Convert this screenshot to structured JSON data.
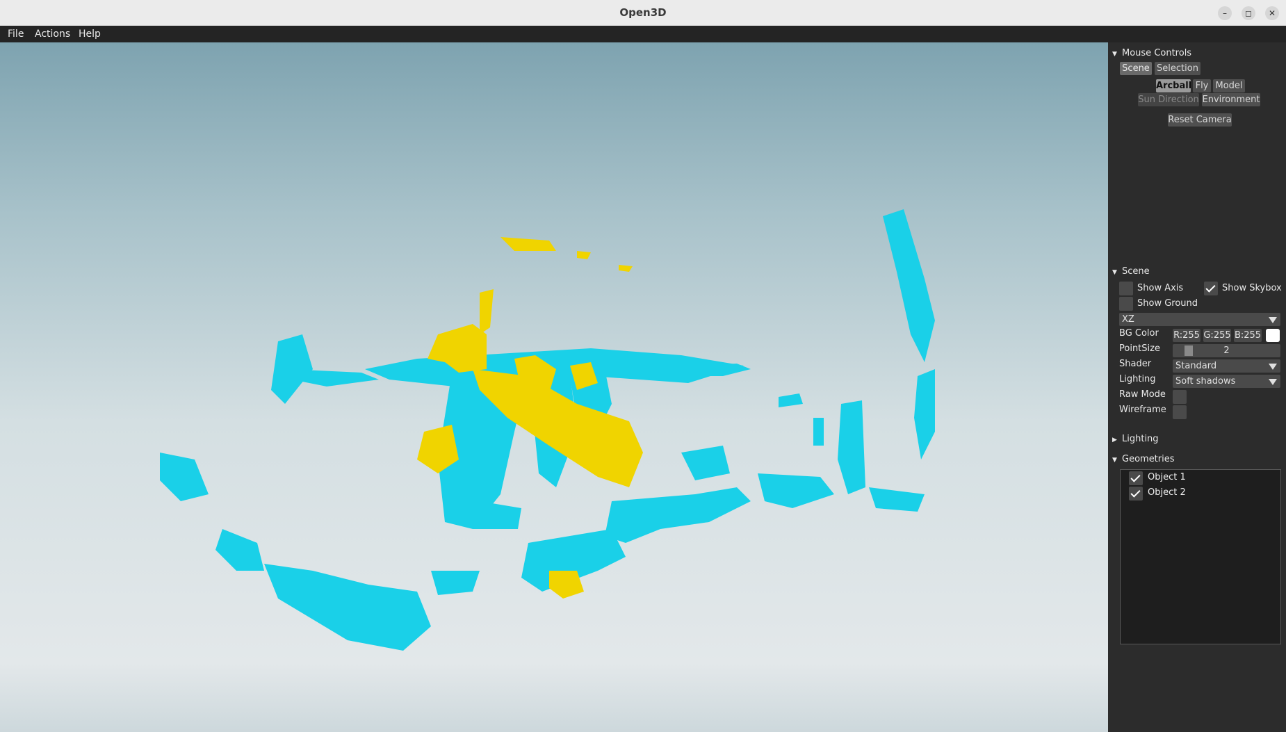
{
  "window": {
    "title": "Open3D",
    "controls": {
      "minimize": "–",
      "maximize": "◻",
      "close": "✕"
    }
  },
  "menu": {
    "file": "File",
    "actions": "Actions",
    "help": "Help"
  },
  "colors": {
    "cloud_cyan": "#1ad0e8",
    "cloud_yellow": "#f0d400",
    "panel_bg": "#2c2c2c"
  },
  "mouse_controls": {
    "header": "Mouse Controls",
    "tabs": {
      "scene": "Scene",
      "selection": "Selection"
    },
    "modes": {
      "arcball": "Arcball",
      "fly": "Fly",
      "model": "Model",
      "sun_direction": "Sun Direction",
      "environment": "Environment"
    },
    "reset_camera": "Reset Camera"
  },
  "scene": {
    "header": "Scene",
    "show_axis": {
      "label": "Show Axis",
      "checked": false
    },
    "show_skybox": {
      "label": "Show Skybox",
      "checked": true
    },
    "show_ground": {
      "label": "Show Ground",
      "checked": false
    },
    "ground_plane": "XZ",
    "bg_color": {
      "label": "BG Color",
      "r": "R:255",
      "g": "G:255",
      "b": "B:255",
      "swatch": "#ffffff"
    },
    "point_size": {
      "label": "PointSize",
      "value": "2"
    },
    "shader": {
      "label": "Shader",
      "value": "Standard"
    },
    "lighting": {
      "label": "Lighting",
      "value": "Soft shadows"
    },
    "raw_mode": {
      "label": "Raw Mode",
      "checked": false
    },
    "wireframe": {
      "label": "Wireframe",
      "checked": false
    }
  },
  "lighting_section": {
    "header": "Lighting"
  },
  "geometries": {
    "header": "Geometries",
    "items": [
      {
        "label": "Object 1",
        "checked": true
      },
      {
        "label": "Object 2",
        "checked": true
      }
    ]
  }
}
